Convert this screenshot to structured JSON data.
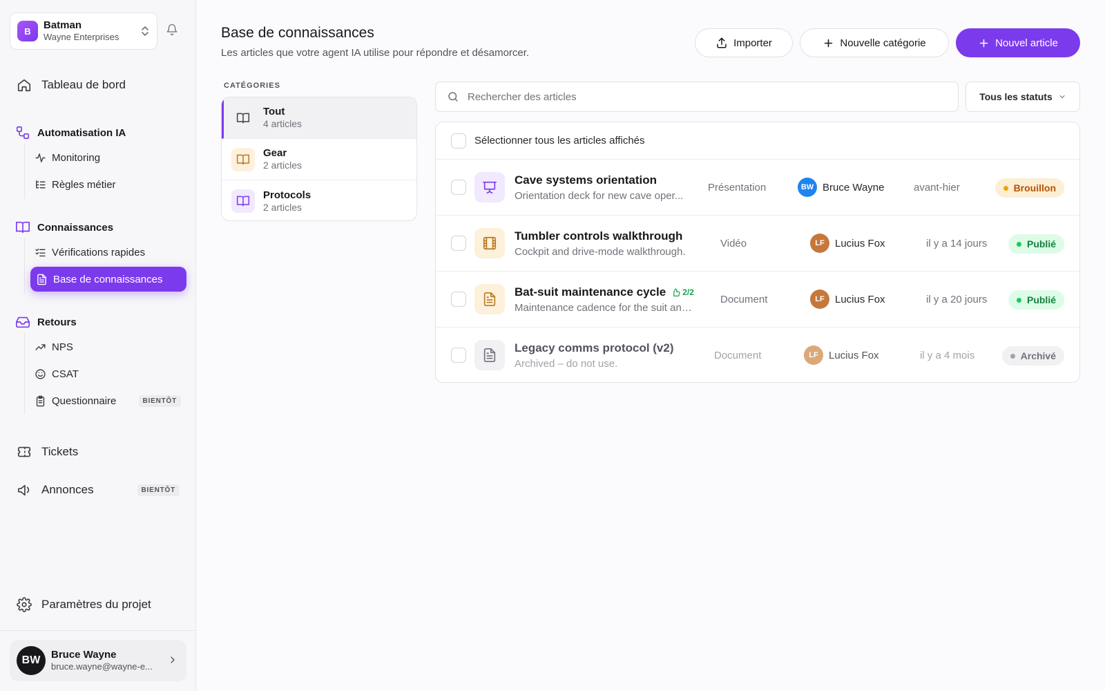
{
  "workspace": {
    "initial": "B",
    "name": "Batman",
    "org": "Wayne Enterprises"
  },
  "nav": {
    "dashboard": "Tableau de bord",
    "ai_section": "Automatisation IA",
    "monitoring": "Monitoring",
    "rules": "Règles métier",
    "knowledge_section": "Connaissances",
    "quick_checks": "Vérifications rapides",
    "knowledge_base": "Base de connaissances",
    "feedback_section": "Retours",
    "nps": "NPS",
    "csat": "CSAT",
    "survey": "Questionnaire",
    "survey_badge": "BIENTÔT",
    "tickets": "Tickets",
    "announcements": "Annonces",
    "announcements_badge": "BIENTÔT",
    "settings": "Paramètres du projet"
  },
  "user": {
    "initials": "BW",
    "name": "Bruce Wayne",
    "email": "bruce.wayne@wayne-e..."
  },
  "page": {
    "title": "Base de connaissances",
    "subtitle": "Les articles que votre agent IA utilise pour répondre et désamorcer."
  },
  "actions": {
    "import": "Importer",
    "new_category": "Nouvelle catégorie",
    "new_article": "Nouvel article"
  },
  "categories": {
    "label": "CATÉGORIES",
    "items": [
      {
        "name": "Tout",
        "count": "4 articles"
      },
      {
        "name": "Gear",
        "count": "2 articles"
      },
      {
        "name": "Protocols",
        "count": "2 articles"
      }
    ]
  },
  "search": {
    "placeholder": "Rechercher des articles"
  },
  "status_filter": {
    "selected": "Tous les statuts"
  },
  "list": {
    "select_all": "Sélectionner tous les articles affichés",
    "rows": [
      {
        "title": "Cave systems orientation",
        "desc": "Orientation deck for new cave oper...",
        "type": "Présentation",
        "author_initials": "BW",
        "author": "Bruce Wayne",
        "date": "avant-hier",
        "status": "Brouillon",
        "icon": "presentation-icon"
      },
      {
        "title": "Tumbler controls walkthrough",
        "desc": "Cockpit and drive-mode walkthrough.",
        "type": "Vidéo",
        "author_initials": "LF",
        "author": "Lucius Fox",
        "date": "il y a 14 jours",
        "status": "Publié",
        "icon": "film-icon"
      },
      {
        "title": "Bat-suit maintenance cycle",
        "votes": "2/2",
        "desc": "Maintenance cadence for the suit and ...",
        "type": "Document",
        "author_initials": "LF",
        "author": "Lucius Fox",
        "date": "il y a 20 jours",
        "status": "Publié",
        "icon": "document-icon"
      },
      {
        "title": "Legacy comms protocol (v2)",
        "desc": "Archived – do not use.",
        "type": "Document",
        "author_initials": "LF",
        "author": "Lucius Fox",
        "date": "il y a 4 mois",
        "status": "Archivé",
        "icon": "document-icon"
      }
    ]
  },
  "colors": {
    "accent": "#7c3aed",
    "draft": "#f59e0b",
    "published": "#22c55e",
    "archived": "#a1a1aa"
  }
}
